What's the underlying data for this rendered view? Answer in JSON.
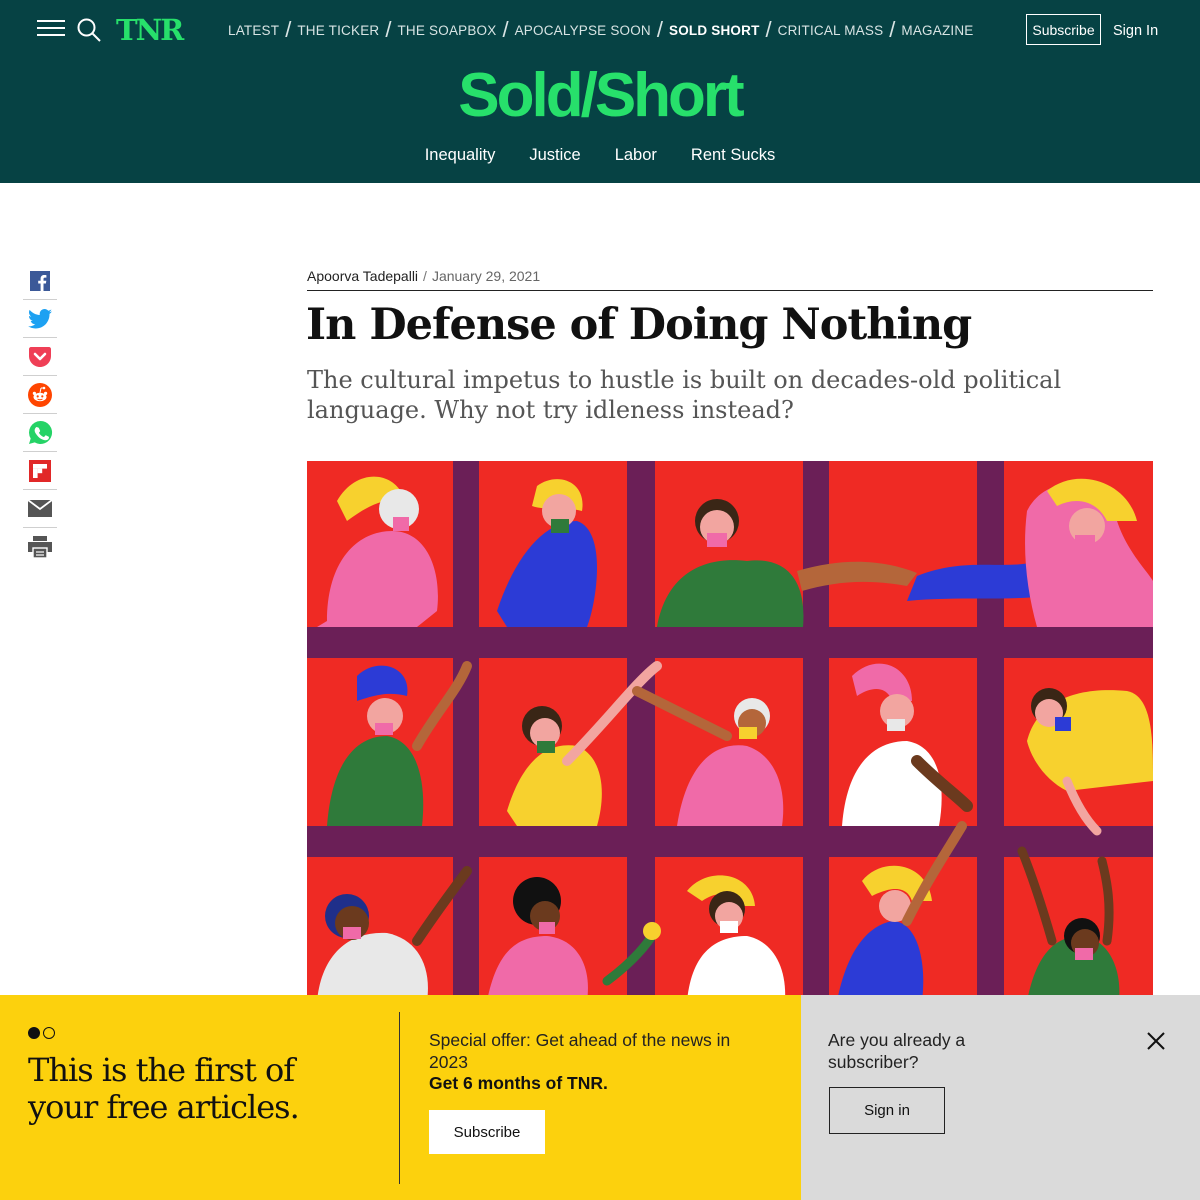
{
  "header": {
    "logo": "TNR",
    "nav": [
      {
        "label": "LATEST",
        "active": false
      },
      {
        "label": "THE TICKER",
        "active": false
      },
      {
        "label": "THE SOAPBOX",
        "active": false
      },
      {
        "label": "APOCALYPSE SOON",
        "active": false
      },
      {
        "label": "SOLD SHORT",
        "active": true
      },
      {
        "label": "CRITICAL MASS",
        "active": false
      },
      {
        "label": "MAGAZINE",
        "active": false
      }
    ],
    "subscribe_label": "Subscribe",
    "signin_label": "Sign In",
    "section_title": "Sold/Short",
    "subnav": [
      "Inequality",
      "Justice",
      "Labor",
      "Rent Sucks"
    ]
  },
  "share": [
    "facebook-icon",
    "twitter-icon",
    "pocket-icon",
    "reddit-icon",
    "whatsapp-icon",
    "flipboard-icon",
    "email-icon",
    "print-icon"
  ],
  "article": {
    "author": "Apoorva Tadepalli",
    "date": "January 29, 2021",
    "headline": "In Defense of Doing Nothing",
    "dek": "The cultural impetus to hustle is built on decades-old political language. Why not try idleness instead?"
  },
  "paywall": {
    "headline": "This is the first of your free articles.",
    "offer_text": "Special offer: Get ahead of the news in 2023",
    "offer_bold": "Get 6 months of TNR.",
    "subscribe_label": "Subscribe",
    "already_text": "Are you already a subscriber?",
    "signin_label": "Sign in",
    "progress": {
      "current": 1,
      "total": 2
    }
  },
  "colors": {
    "header_bg": "#064244",
    "brand_green": "#27e06b",
    "paywall_yellow": "#fcd10d",
    "paywall_gray": "#dadada",
    "hero_red": "#ef2a24",
    "hero_purple": "#6b1f57"
  }
}
